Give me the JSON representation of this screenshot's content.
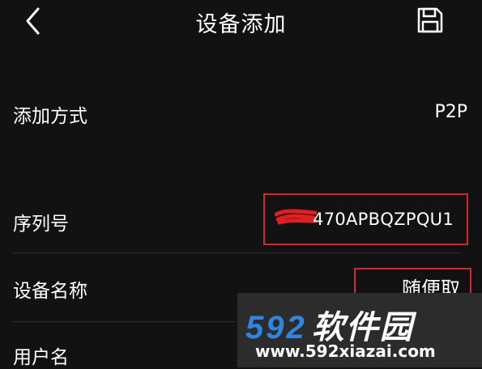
{
  "header": {
    "title": "设备添加",
    "back_icon": "chevron-left-icon",
    "save_icon": "floppy-disk-icon"
  },
  "rows": {
    "add_method": {
      "label": "添加方式",
      "value": "P2P"
    },
    "serial": {
      "label": "序列号",
      "value": "470APBQZPQU1"
    },
    "device_name": {
      "label": "设备名称",
      "value": "随便取"
    },
    "username": {
      "label": "用户名"
    }
  },
  "watermark": {
    "digits": "592",
    "brand": "软件园",
    "url": "www.592xiazai.com"
  },
  "colors": {
    "background": "#121212",
    "highlight_border": "#d8242a",
    "redaction": "#e02020",
    "watermark_blue": "#2f86e0"
  }
}
